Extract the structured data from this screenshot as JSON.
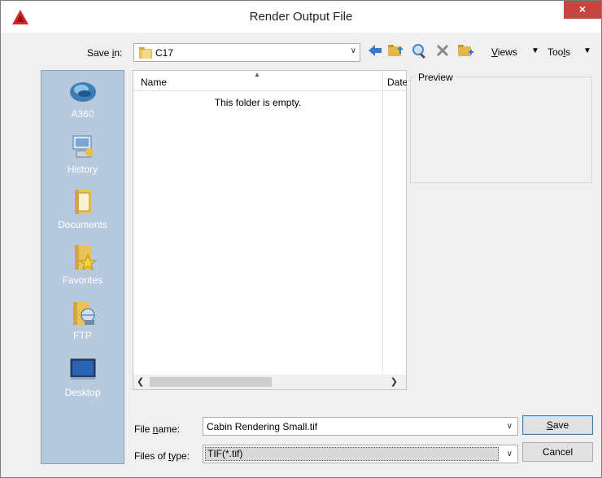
{
  "window": {
    "title": "Render Output File",
    "close_glyph": "×"
  },
  "savein": {
    "label_before": "Save ",
    "label_underline": "i",
    "label_after": "n:",
    "value": "C17"
  },
  "toolbar": {
    "views_underline": "V",
    "views_rest": "iews",
    "tools_before": "Too",
    "tools_underline": "l",
    "tools_after": "s",
    "icons": [
      "back-arrow-icon",
      "up-folder-icon",
      "search-web-icon",
      "delete-icon",
      "new-folder-icon"
    ]
  },
  "places": [
    {
      "label": "A360",
      "icon": "a360-cloud-icon"
    },
    {
      "label": "History",
      "icon": "history-icon"
    },
    {
      "label": "Documents",
      "icon": "documents-folder-icon"
    },
    {
      "label": "Favorites",
      "icon": "favorites-folder-icon"
    },
    {
      "label": "FTP",
      "icon": "ftp-icon"
    },
    {
      "label": "Desktop",
      "icon": "desktop-icon"
    }
  ],
  "filelist": {
    "col_name": "Name",
    "col_date": "Date",
    "empty_message": "This folder is empty."
  },
  "preview": {
    "label": "Preview"
  },
  "filename": {
    "label_before": "File ",
    "label_underline": "n",
    "label_after": "ame:",
    "value": "Cabin Rendering Small.tif"
  },
  "filetype": {
    "label_before": "Files of ",
    "label_underline": "t",
    "label_after": "ype:",
    "value": "TIF(*.tif)"
  },
  "buttons": {
    "save_underline": "S",
    "save_rest": "ave",
    "cancel": "Cancel"
  },
  "colors": {
    "places_bg": "#b7c9dc",
    "close_bg": "#c7463d",
    "accent": "#1c6fc4"
  }
}
